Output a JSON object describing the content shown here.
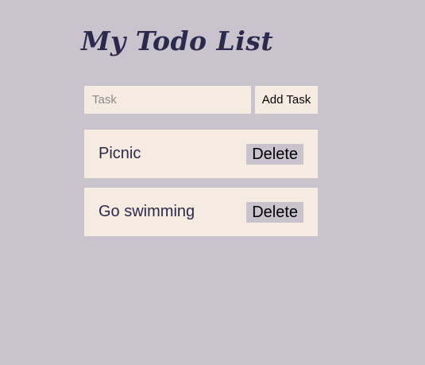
{
  "header": {
    "title": "My Todo List"
  },
  "form": {
    "task_placeholder": "Task",
    "task_value": "",
    "add_button_label": "Add Task"
  },
  "todos": [
    {
      "text": "Picnic",
      "delete_label": "Delete"
    },
    {
      "text": "Go swimming",
      "delete_label": "Delete"
    }
  ],
  "colors": {
    "background": "#c9c3ce",
    "card": "#f5ebe1",
    "text": "#2b2a4c"
  }
}
